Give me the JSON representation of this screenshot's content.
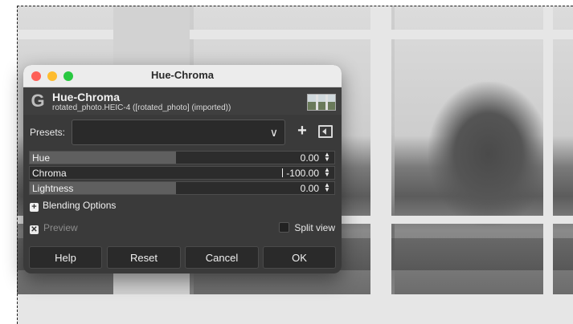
{
  "dialog": {
    "window_title": "Hue-Chroma",
    "header_title": "Hue-Chroma",
    "header_subtitle": "rotated_photo.HEIC-4 ([rotated_photo] (imported))",
    "logo_letter": "G"
  },
  "presets": {
    "label": "Presets:",
    "value": "",
    "chevron": "∨",
    "add_glyph": "+"
  },
  "sliders": [
    {
      "label": "Hue",
      "value": "0.00",
      "fill_fraction": 0.48
    },
    {
      "label": "Chroma",
      "value": "-100.00",
      "fill_fraction": 0.0
    },
    {
      "label": "Lightness",
      "value": "0.00",
      "fill_fraction": 0.48
    }
  ],
  "spin_glyph": "⌃\n⌄",
  "blending": {
    "label": "Blending Options",
    "glyph": "+"
  },
  "preview": {
    "label": "Preview",
    "checked": true,
    "glyph": "✕"
  },
  "split_view": {
    "label": "Split view",
    "checked": false
  },
  "buttons": {
    "help": "Help",
    "reset": "Reset",
    "cancel": "Cancel",
    "ok": "OK"
  },
  "colors": {
    "dialog_bg": "#3a3a3a",
    "slider_fill": "#5f5f5f",
    "titlebar": "#ececec"
  },
  "icons": [
    "gimp-logo-icon",
    "chevron-down-icon",
    "plus-icon",
    "preset-menu-icon",
    "spin-arrows-icon",
    "checkbox-icon"
  ]
}
